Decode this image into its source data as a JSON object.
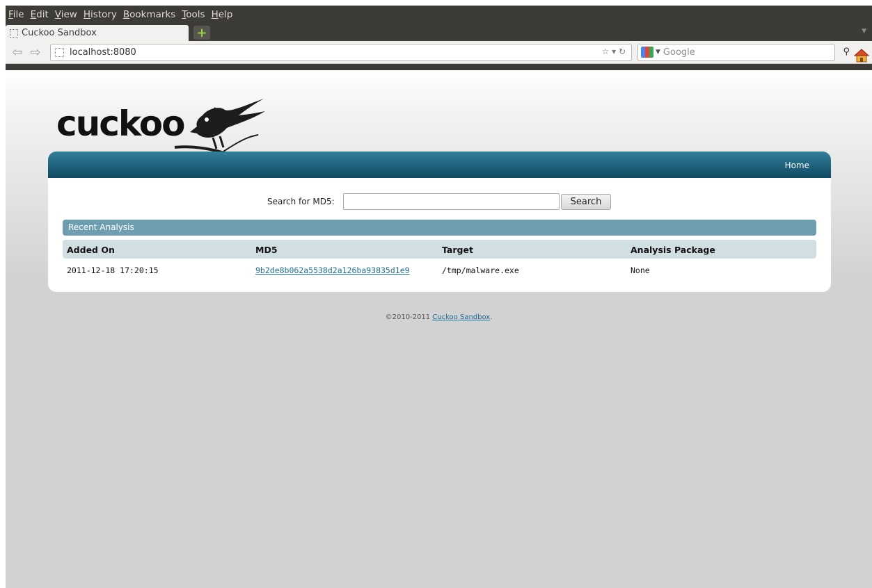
{
  "browser": {
    "menu": [
      "File",
      "Edit",
      "View",
      "History",
      "Bookmarks",
      "Tools",
      "Help"
    ],
    "tab_title": "Cuckoo Sandbox",
    "url": "localhost:8080",
    "search_placeholder": "Google"
  },
  "page": {
    "logo_text": "cuckoo",
    "nav_home": "Home",
    "search_label": "Search for MD5:",
    "search_value": "",
    "search_button": "Search",
    "section_title": "Recent Analysis",
    "columns": [
      "Added On",
      "MD5",
      "Target",
      "Analysis Package"
    ],
    "rows": [
      {
        "added_on": "2011-12-18 17:20:15",
        "md5": "9b2de8b062a5538d2a126ba93835d1e9",
        "target": "/tmp/malware.exe",
        "package": "None"
      }
    ],
    "footer_prefix": "©2010-2011 ",
    "footer_link": "Cuckoo Sandbox",
    "footer_suffix": "."
  }
}
